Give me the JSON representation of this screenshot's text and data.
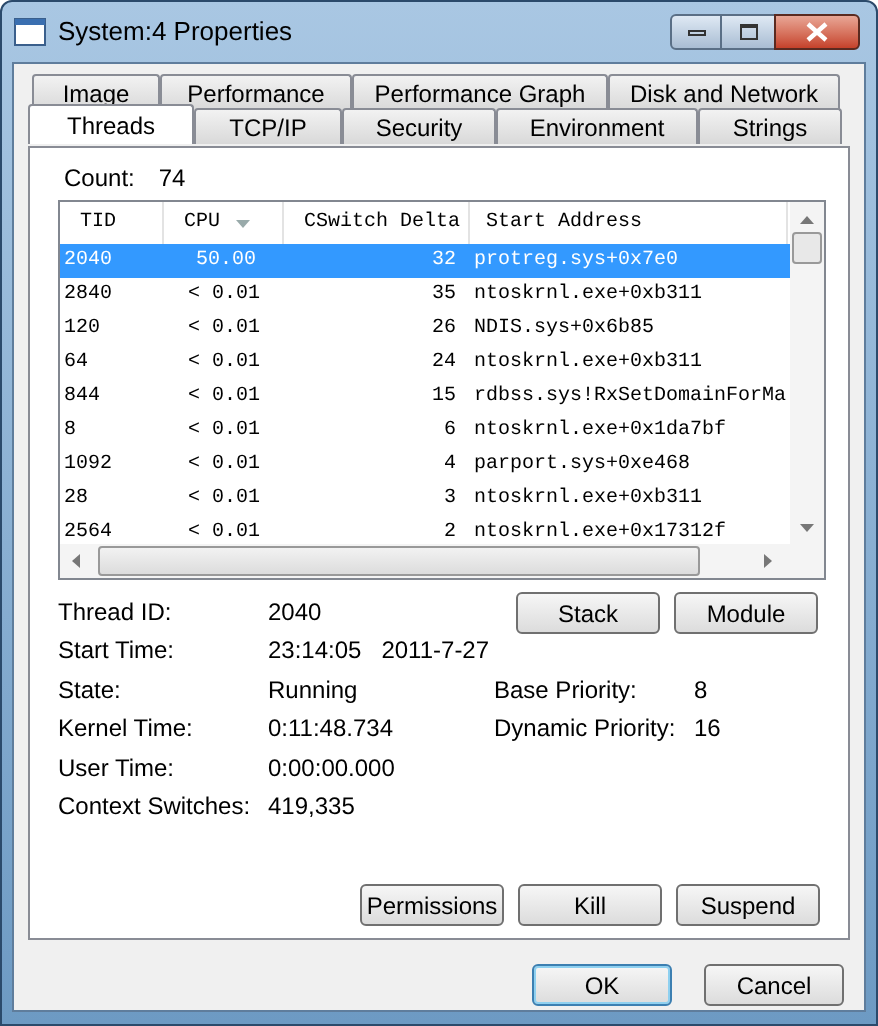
{
  "window": {
    "title": "System:4 Properties"
  },
  "tab_rows": [
    [
      {
        "label": "Image",
        "selected": false
      },
      {
        "label": "Performance",
        "selected": false
      },
      {
        "label": "Performance Graph",
        "selected": false
      },
      {
        "label": "Disk and Network",
        "selected": false
      }
    ],
    [
      {
        "label": "Threads",
        "selected": true
      },
      {
        "label": "TCP/IP",
        "selected": false
      },
      {
        "label": "Security",
        "selected": false
      },
      {
        "label": "Environment",
        "selected": false
      },
      {
        "label": "Strings",
        "selected": false
      }
    ]
  ],
  "count": {
    "label": "Count:",
    "value": "74"
  },
  "table": {
    "columns": [
      {
        "label": "TID",
        "sorted": false
      },
      {
        "label": "CPU",
        "sorted": true
      },
      {
        "label": "CSwitch Delta",
        "sorted": false
      },
      {
        "label": "Start Address",
        "sorted": false
      }
    ],
    "rows": [
      {
        "selected": true,
        "cells": [
          "2040",
          "50.00",
          "32",
          "protreg.sys+0x7e0"
        ]
      },
      {
        "selected": false,
        "cells": [
          "2840",
          "< 0.01",
          "35",
          "ntoskrnl.exe+0xb311"
        ]
      },
      {
        "selected": false,
        "cells": [
          "120",
          "< 0.01",
          "26",
          "NDIS.sys+0x6b85"
        ]
      },
      {
        "selected": false,
        "cells": [
          "64",
          "< 0.01",
          "24",
          "ntoskrnl.exe+0xb311"
        ]
      },
      {
        "selected": false,
        "cells": [
          "844",
          "< 0.01",
          "15",
          "rdbss.sys!RxSetDomainForMa"
        ]
      },
      {
        "selected": false,
        "cells": [
          "8",
          "< 0.01",
          "6",
          "ntoskrnl.exe+0x1da7bf"
        ]
      },
      {
        "selected": false,
        "cells": [
          "1092",
          "< 0.01",
          "4",
          "parport.sys+0xe468"
        ]
      },
      {
        "selected": false,
        "cells": [
          "28",
          "< 0.01",
          "3",
          "ntoskrnl.exe+0xb311"
        ]
      },
      {
        "selected": false,
        "cells": [
          "2564",
          "< 0.01",
          "2",
          "ntoskrnl.exe+0x17312f"
        ]
      }
    ]
  },
  "details": [
    {
      "label": "Thread ID:",
      "value": "2040"
    },
    {
      "label": "Start Time:",
      "value": "23:14:05   2011-7-27"
    },
    {
      "label": "State:",
      "value": "Running"
    },
    {
      "label": "Kernel Time:",
      "value": "0:11:48.734"
    },
    {
      "label": "User Time:",
      "value": "0:00:00.000"
    },
    {
      "label": "Context Switches:",
      "value": "419,335"
    }
  ],
  "priorities": [
    {
      "label": "Base Priority:",
      "value": "8"
    },
    {
      "label": "Dynamic Priority:",
      "value": "16"
    }
  ],
  "top_buttons": [
    "Stack",
    "Module"
  ],
  "action_buttons": [
    "Permissions",
    "Kill",
    "Suspend"
  ],
  "dialog_buttons": [
    {
      "label": "OK",
      "default": true
    },
    {
      "label": "Cancel",
      "default": false
    }
  ]
}
